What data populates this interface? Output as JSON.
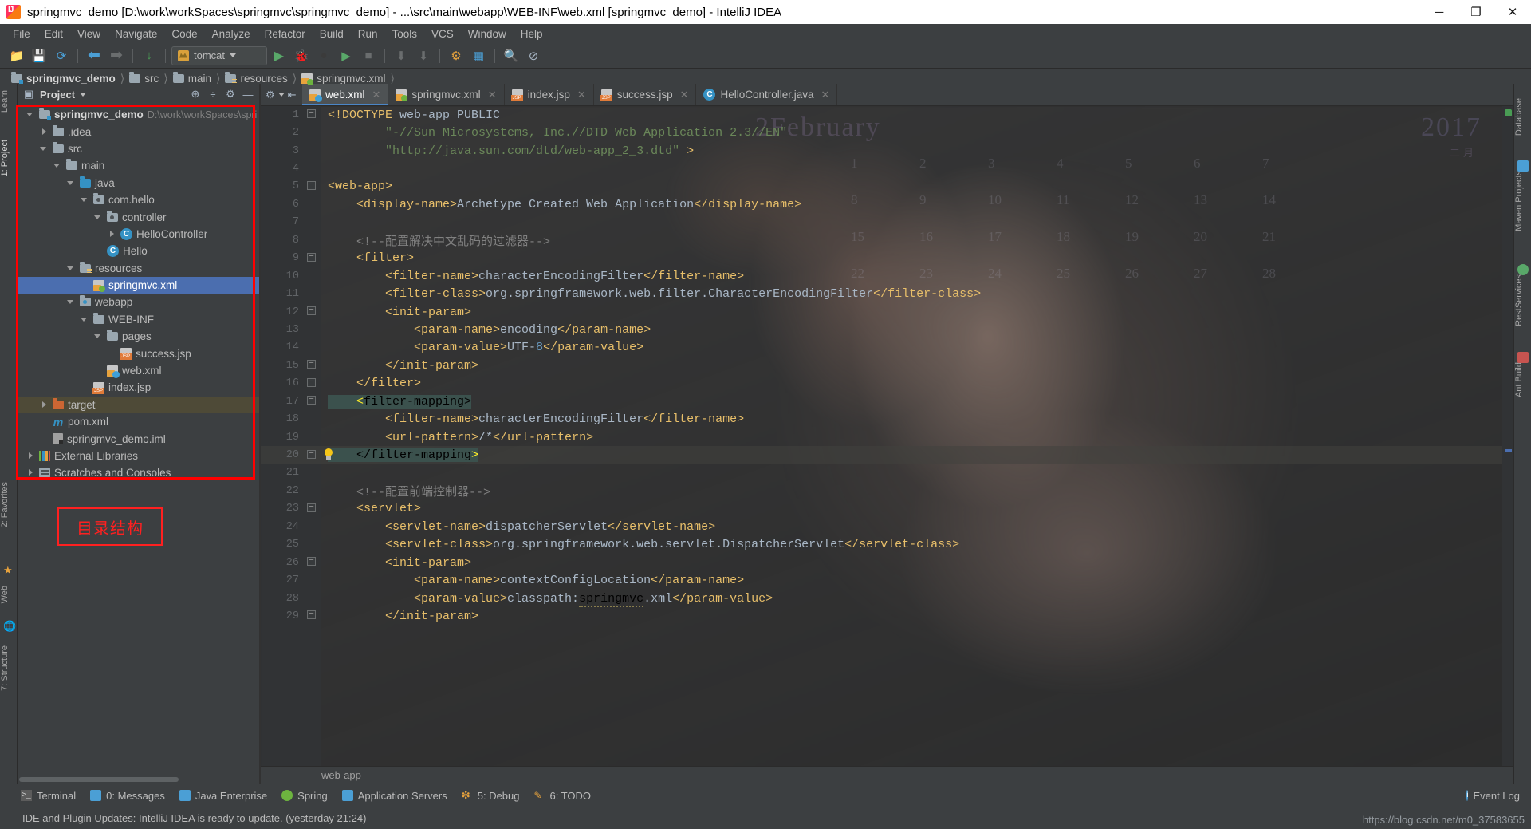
{
  "window": {
    "title": "springmvc_demo [D:\\work\\workSpaces\\springmvc\\springmvc_demo] - ...\\src\\main\\webapp\\WEB-INF\\web.xml [springmvc_demo] - IntelliJ IDEA",
    "minimize": "─",
    "maximize": "❐",
    "close": "✕",
    "app_icon": "intellij-idea-icon"
  },
  "menubar": {
    "items": [
      "File",
      "Edit",
      "View",
      "Navigate",
      "Code",
      "Analyze",
      "Refactor",
      "Build",
      "Run",
      "Tools",
      "VCS",
      "Window",
      "Help"
    ]
  },
  "toolbar": {
    "buttons": [
      {
        "name": "open-project",
        "glyph": "📂"
      },
      {
        "name": "save-all",
        "glyph": "💾"
      },
      {
        "name": "sync",
        "glyph": "⟳"
      },
      {
        "name": "back",
        "glyph": "←"
      },
      {
        "name": "forward",
        "glyph": "→"
      },
      {
        "name": "compile",
        "glyph": "↓"
      },
      {
        "name": "run",
        "glyph": "▶"
      },
      {
        "name": "debug",
        "glyph": "🐞"
      },
      {
        "name": "run-coverage",
        "glyph": "●"
      },
      {
        "name": "profile",
        "glyph": "▶"
      },
      {
        "name": "stop",
        "glyph": "■"
      },
      {
        "name": "update-app",
        "glyph": "⬇"
      },
      {
        "name": "redeploy",
        "glyph": "⬇"
      },
      {
        "name": "settings",
        "glyph": "⚙"
      },
      {
        "name": "project-structure",
        "glyph": "▦"
      },
      {
        "name": "search-everywhere",
        "glyph": "🔍"
      },
      {
        "name": "no-entry",
        "glyph": "⊘"
      }
    ],
    "run_config": {
      "label": "tomcat",
      "icon": "tomcat-icon"
    }
  },
  "breadcrumbs": [
    {
      "label": "springmvc_demo",
      "icon": "module-folder-icon",
      "bold": true
    },
    {
      "label": "src",
      "icon": "folder-icon",
      "bold": false
    },
    {
      "label": "main",
      "icon": "folder-icon",
      "bold": false
    },
    {
      "label": "resources",
      "icon": "resources-folder-icon",
      "bold": false
    },
    {
      "label": "springmvc.xml",
      "icon": "spring-xml-icon",
      "bold": false
    }
  ],
  "left_stripes": [
    {
      "label": "1: Project",
      "active": true
    },
    {
      "label": "2: Favorites",
      "active": false
    },
    {
      "label": "Web",
      "active": false
    },
    {
      "label": "7: Structure",
      "active": false
    }
  ],
  "left_stripe_top": {
    "label": "Learn"
  },
  "right_stripes": [
    {
      "label": "Database"
    },
    {
      "label": "Maven Projects"
    },
    {
      "label": "RestServices"
    },
    {
      "label": "Ant Build"
    }
  ],
  "project_panel": {
    "title": "Project",
    "dropdown_caret": "▾",
    "icons": [
      {
        "name": "locate-icon",
        "glyph": "⊕"
      },
      {
        "name": "collapse-all-icon",
        "glyph": "÷"
      },
      {
        "name": "settings-gear-icon",
        "glyph": "⚙"
      },
      {
        "name": "hide-icon",
        "glyph": "―"
      }
    ],
    "tree": [
      {
        "depth": 0,
        "arrow": "down",
        "icon": "module-folder-icon",
        "label": "springmvc_demo",
        "bold": true,
        "path": "D:\\work\\workSpaces\\spri",
        "state": "normal"
      },
      {
        "depth": 1,
        "arrow": "right",
        "icon": "folder-icon",
        "label": ".idea",
        "bold": false,
        "path": "",
        "state": "normal"
      },
      {
        "depth": 1,
        "arrow": "down",
        "icon": "folder-icon",
        "label": "src",
        "bold": false,
        "path": "",
        "state": "normal"
      },
      {
        "depth": 2,
        "arrow": "down",
        "icon": "folder-icon",
        "label": "main",
        "bold": false,
        "path": "",
        "state": "normal"
      },
      {
        "depth": 3,
        "arrow": "down",
        "icon": "source-folder-icon",
        "label": "java",
        "bold": false,
        "path": "",
        "state": "normal"
      },
      {
        "depth": 4,
        "arrow": "down",
        "icon": "package-icon",
        "label": "com.hello",
        "bold": false,
        "path": "",
        "state": "normal"
      },
      {
        "depth": 5,
        "arrow": "down",
        "icon": "package-icon",
        "label": "controller",
        "bold": false,
        "path": "",
        "state": "normal"
      },
      {
        "depth": 6,
        "arrow": "right",
        "icon": "java-class-icon",
        "label": "HelloController",
        "bold": false,
        "path": "",
        "state": "normal"
      },
      {
        "depth": 5,
        "arrow": "none",
        "icon": "java-class-icon",
        "label": "Hello",
        "bold": false,
        "path": "",
        "state": "normal"
      },
      {
        "depth": 3,
        "arrow": "down",
        "icon": "resources-folder-icon",
        "label": "resources",
        "bold": false,
        "path": "",
        "state": "normal"
      },
      {
        "depth": 4,
        "arrow": "none",
        "icon": "spring-xml-icon",
        "label": "springmvc.xml",
        "bold": false,
        "path": "",
        "state": "selected"
      },
      {
        "depth": 3,
        "arrow": "down",
        "icon": "webapp-folder-icon",
        "label": "webapp",
        "bold": false,
        "path": "",
        "state": "normal"
      },
      {
        "depth": 4,
        "arrow": "down",
        "icon": "folder-icon",
        "label": "WEB-INF",
        "bold": false,
        "path": "",
        "state": "normal"
      },
      {
        "depth": 5,
        "arrow": "down",
        "icon": "folder-icon",
        "label": "pages",
        "bold": false,
        "path": "",
        "state": "normal"
      },
      {
        "depth": 6,
        "arrow": "none",
        "icon": "jsp-icon",
        "label": "success.jsp",
        "bold": false,
        "path": "",
        "state": "normal"
      },
      {
        "depth": 5,
        "arrow": "none",
        "icon": "web-xml-icon",
        "label": "web.xml",
        "bold": false,
        "path": "",
        "state": "normal"
      },
      {
        "depth": 4,
        "arrow": "none",
        "icon": "jsp-icon",
        "label": "index.jsp",
        "bold": false,
        "path": "",
        "state": "normal"
      },
      {
        "depth": 1,
        "arrow": "right",
        "icon": "target-folder-icon",
        "label": "target",
        "bold": false,
        "path": "",
        "state": "highlight"
      },
      {
        "depth": 1,
        "arrow": "none",
        "icon": "maven-icon",
        "label": "pom.xml",
        "bold": false,
        "path": "",
        "state": "normal"
      },
      {
        "depth": 1,
        "arrow": "none",
        "icon": "iml-icon",
        "label": "springmvc_demo.iml",
        "bold": false,
        "path": "",
        "state": "normal"
      },
      {
        "depth": 0,
        "arrow": "right",
        "icon": "libraries-icon",
        "label": "External Libraries",
        "bold": false,
        "path": "",
        "state": "normal"
      },
      {
        "depth": 0,
        "arrow": "right",
        "icon": "scratches-icon",
        "label": "Scratches and Consoles",
        "bold": false,
        "path": "",
        "state": "normal"
      }
    ]
  },
  "annotations": {
    "tree_box_label": "directory-structure-highlight-box",
    "callout_text": "目录结构",
    "box_color": "#ff0000"
  },
  "editor": {
    "tool_icons": [
      {
        "name": "editor-settings-gear-icon",
        "glyph": "⚙"
      },
      {
        "name": "hide-sidebar-icon",
        "glyph": "⇤"
      }
    ],
    "tabs": [
      {
        "label": "web.xml",
        "icon": "web-xml-icon",
        "active": true,
        "close": "✕"
      },
      {
        "label": "springmvc.xml",
        "icon": "spring-xml-icon",
        "active": false,
        "close": "✕"
      },
      {
        "label": "index.jsp",
        "icon": "jsp-icon",
        "active": false,
        "close": "✕"
      },
      {
        "label": "success.jsp",
        "icon": "jsp-icon",
        "active": false,
        "close": "✕"
      },
      {
        "label": "HelloController.java",
        "icon": "java-class-icon",
        "active": false,
        "close": "✕"
      }
    ],
    "breadcrumb": "web-app",
    "background_watermark": {
      "month": "2February",
      "year": "2017",
      "subtitle": "二月",
      "day_numbers": [
        "1",
        "2",
        "3",
        "4",
        "5",
        "6",
        "7",
        "8",
        "9",
        "10",
        "11",
        "12",
        "13",
        "14",
        "15",
        "16",
        "17",
        "18",
        "19",
        "20",
        "21",
        "22",
        "23",
        "24",
        "25",
        "26",
        "27",
        "28"
      ]
    },
    "lines": [
      {
        "n": 1,
        "indent": 0,
        "fold": "open",
        "highlight": false,
        "segs": [
          {
            "t": "tag",
            "v": "<!DOCTYPE"
          },
          {
            "t": "text",
            "v": " web-app PUBLIC"
          }
        ]
      },
      {
        "n": 2,
        "indent": 0,
        "fold": "",
        "highlight": false,
        "segs": [
          {
            "t": "str",
            "v": "        \"-//Sun Microsystems, Inc.//DTD Web Application 2.3//EN\""
          }
        ]
      },
      {
        "n": 3,
        "indent": 0,
        "fold": "",
        "highlight": false,
        "segs": [
          {
            "t": "str",
            "v": "        \"http://java.sun.com/dtd/web-app_2_3.dtd\""
          },
          {
            "t": "tag",
            "v": " >"
          }
        ]
      },
      {
        "n": 4,
        "indent": 0,
        "fold": "",
        "highlight": false,
        "segs": []
      },
      {
        "n": 5,
        "indent": 0,
        "fold": "open",
        "highlight": false,
        "segs": [
          {
            "t": "tag",
            "v": "<web-app>"
          }
        ]
      },
      {
        "n": 6,
        "indent": 0,
        "fold": "",
        "highlight": false,
        "segs": [
          {
            "t": "tag",
            "v": "    <display-name>"
          },
          {
            "t": "text",
            "v": "Archetype Created Web Application"
          },
          {
            "t": "tag",
            "v": "</display-name>"
          }
        ]
      },
      {
        "n": 7,
        "indent": 0,
        "fold": "",
        "highlight": false,
        "segs": []
      },
      {
        "n": 8,
        "indent": 0,
        "fold": "",
        "highlight": false,
        "segs": [
          {
            "t": "com",
            "v": "    <!--配置解决中文乱码的过滤器-->"
          }
        ]
      },
      {
        "n": 9,
        "indent": 0,
        "fold": "open",
        "highlight": false,
        "segs": [
          {
            "t": "tag",
            "v": "    <filter>"
          }
        ]
      },
      {
        "n": 10,
        "indent": 0,
        "fold": "",
        "highlight": false,
        "segs": [
          {
            "t": "tag",
            "v": "        <filter-name>"
          },
          {
            "t": "text",
            "v": "characterEncodingFilter"
          },
          {
            "t": "tag",
            "v": "</filter-name>"
          }
        ]
      },
      {
        "n": 11,
        "indent": 0,
        "fold": "",
        "highlight": false,
        "segs": [
          {
            "t": "tag",
            "v": "        <filter-class>"
          },
          {
            "t": "text",
            "v": "org.springframework.web.filter.CharacterEncodingFilter"
          },
          {
            "t": "tag",
            "v": "</filter-class>"
          }
        ]
      },
      {
        "n": 12,
        "indent": 0,
        "fold": "open",
        "highlight": false,
        "segs": [
          {
            "t": "tag",
            "v": "        <init-param>"
          }
        ]
      },
      {
        "n": 13,
        "indent": 0,
        "fold": "",
        "highlight": false,
        "segs": [
          {
            "t": "tag",
            "v": "            <param-name>"
          },
          {
            "t": "text",
            "v": "encoding"
          },
          {
            "t": "tag",
            "v": "</param-name>"
          }
        ]
      },
      {
        "n": 14,
        "indent": 0,
        "fold": "",
        "highlight": false,
        "segs": [
          {
            "t": "tag",
            "v": "            <param-value>"
          },
          {
            "t": "text",
            "v": "UTF-"
          },
          {
            "t": "num",
            "v": "8"
          },
          {
            "t": "tag",
            "v": "</param-value>"
          }
        ]
      },
      {
        "n": 15,
        "indent": 0,
        "fold": "close",
        "highlight": false,
        "segs": [
          {
            "t": "tag",
            "v": "        </init-param>"
          }
        ]
      },
      {
        "n": 16,
        "indent": 0,
        "fold": "close",
        "highlight": false,
        "segs": [
          {
            "t": "tag",
            "v": "    </filter>"
          }
        ]
      },
      {
        "n": 17,
        "indent": 0,
        "fold": "open",
        "highlight": false,
        "segs": [
          {
            "t": "brmatch",
            "v": "    <"
          },
          {
            "t": "hlmark",
            "v": "filter-mapping>"
          }
        ]
      },
      {
        "n": 18,
        "indent": 0,
        "fold": "",
        "highlight": false,
        "segs": [
          {
            "t": "tag",
            "v": "        <filter-name>"
          },
          {
            "t": "text",
            "v": "characterEncodingFilter"
          },
          {
            "t": "tag",
            "v": "</filter-name>"
          }
        ]
      },
      {
        "n": 19,
        "indent": 0,
        "fold": "",
        "highlight": false,
        "segs": [
          {
            "t": "tag",
            "v": "        <url-pattern>"
          },
          {
            "t": "text",
            "v": "/*"
          },
          {
            "t": "tag",
            "v": "</url-pattern>"
          }
        ]
      },
      {
        "n": 20,
        "indent": 0,
        "fold": "close",
        "highlight": true,
        "bulb": true,
        "segs": [
          {
            "t": "hlmark",
            "v": "    </filter-mapping"
          },
          {
            "t": "brmatch",
            "v": ">"
          }
        ]
      },
      {
        "n": 21,
        "indent": 0,
        "fold": "",
        "highlight": false,
        "segs": []
      },
      {
        "n": 22,
        "indent": 0,
        "fold": "",
        "highlight": false,
        "segs": [
          {
            "t": "com",
            "v": "    <!--配置前端控制器-->"
          }
        ]
      },
      {
        "n": 23,
        "indent": 0,
        "fold": "open",
        "highlight": false,
        "segs": [
          {
            "t": "tag",
            "v": "    <servlet>"
          }
        ]
      },
      {
        "n": 24,
        "indent": 0,
        "fold": "",
        "highlight": false,
        "segs": [
          {
            "t": "tag",
            "v": "        <servlet-name>"
          },
          {
            "t": "text",
            "v": "dispatcherServlet"
          },
          {
            "t": "tag",
            "v": "</servlet-name>"
          }
        ]
      },
      {
        "n": 25,
        "indent": 0,
        "fold": "",
        "highlight": false,
        "segs": [
          {
            "t": "tag",
            "v": "        <servlet-class>"
          },
          {
            "t": "text",
            "v": "org.springframework.web.servlet.DispatcherServlet"
          },
          {
            "t": "tag",
            "v": "</servlet-class>"
          }
        ]
      },
      {
        "n": 26,
        "indent": 0,
        "fold": "open",
        "highlight": false,
        "segs": [
          {
            "t": "tag",
            "v": "        <init-param>"
          }
        ]
      },
      {
        "n": 27,
        "indent": 0,
        "fold": "",
        "highlight": false,
        "segs": [
          {
            "t": "tag",
            "v": "            <param-name>"
          },
          {
            "t": "text",
            "v": "contextConfigLocation"
          },
          {
            "t": "tag",
            "v": "</param-name>"
          }
        ]
      },
      {
        "n": 28,
        "indent": 0,
        "fold": "",
        "highlight": false,
        "segs": [
          {
            "t": "tag",
            "v": "            <param-value>"
          },
          {
            "t": "text",
            "v": "classpath:"
          },
          {
            "t": "squig",
            "v": "springmvc"
          },
          {
            "t": "text",
            "v": ".xml"
          },
          {
            "t": "tag",
            "v": "</param-value>"
          }
        ]
      },
      {
        "n": 29,
        "indent": 0,
        "fold": "close",
        "highlight": false,
        "segs": [
          {
            "t": "tag",
            "v": "        </init-param>"
          }
        ]
      }
    ]
  },
  "bottom_tools": [
    {
      "label": "Terminal",
      "icon": "terminal-icon"
    },
    {
      "label": "0: Messages",
      "icon": "messages-icon"
    },
    {
      "label": "Java Enterprise",
      "icon": "java-enterprise-icon"
    },
    {
      "label": "Spring",
      "icon": "spring-leaf-icon"
    },
    {
      "label": "Application Servers",
      "icon": "app-servers-icon"
    },
    {
      "label": "5: Debug",
      "icon": "debug-icon"
    },
    {
      "label": "6: TODO",
      "icon": "todo-icon"
    }
  ],
  "event_log": {
    "label": "Event Log",
    "icon": "event-log-icon"
  },
  "statusbar": {
    "message": "IDE and Plugin Updates: IntelliJ IDEA is ready to update. (yesterday 21:24)"
  },
  "watermark": "https://blog.csdn.net/m0_37583655",
  "colors": {
    "accent": "#4b6eaf",
    "selection": "#4b6eaf",
    "editor_bg": "#2b2b2b",
    "panel_bg": "#3c3f41",
    "annotation_red": "#ff0000",
    "tag": "#e8bf6a",
    "string": "#6a8759",
    "comment": "#808080",
    "number": "#6897bb",
    "text": "#a9b7c6"
  }
}
